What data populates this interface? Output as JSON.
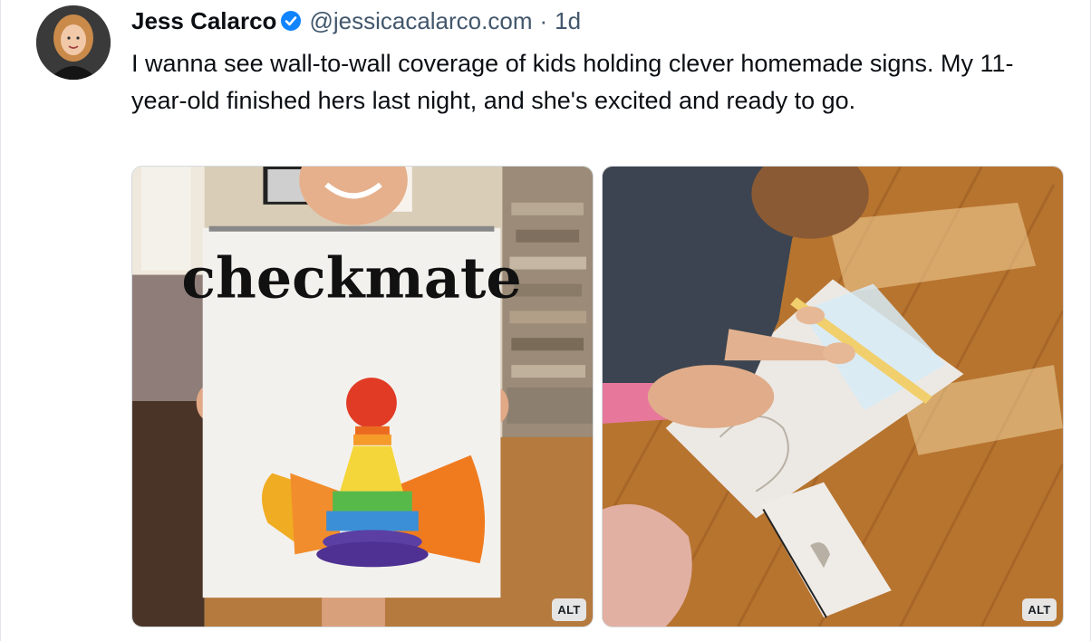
{
  "post": {
    "author": {
      "display_name": "Jess Calarco",
      "handle": "@jessicacalarco.com",
      "verified": true,
      "avatar_icon": "avatar-photo"
    },
    "separator": "·",
    "timestamp": "1d",
    "text": "I wanna see wall-to-wall coverage of kids holding clever homemade signs. My 11-year-old finished hers last night, and she's excited and ready to go.",
    "images": [
      {
        "alt_badge": "ALT",
        "sign_word": "checkmate"
      },
      {
        "alt_badge": "ALT"
      }
    ]
  },
  "colors": {
    "verified_blue": "#1083fe",
    "text_primary": "#0b0f14",
    "text_secondary": "#42576c"
  }
}
